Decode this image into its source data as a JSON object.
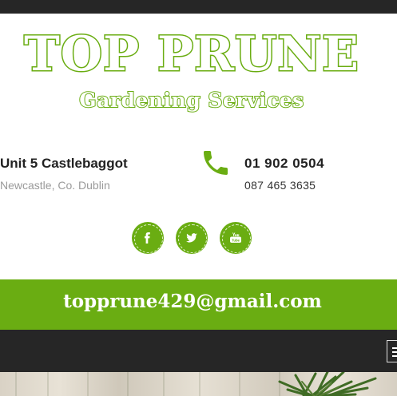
{
  "logo": {
    "title": "TOP PRUNE",
    "subtitle": "Gardening Services",
    "brand_color": "#6aad12"
  },
  "address": {
    "line1": "Unit 5 Castlebaggot",
    "line2": "Newcastle, Co. Dublin"
  },
  "contact": {
    "icon": "phone-icon",
    "phone_main": "01 902 0504",
    "phone_alt": "087 465 3635"
  },
  "social": [
    {
      "network": "facebook",
      "icon": "facebook-icon"
    },
    {
      "network": "twitter",
      "icon": "twitter-icon"
    },
    {
      "network": "youtube",
      "icon": "youtube-icon"
    }
  ],
  "email": {
    "address": "topprune429@gmail.com"
  },
  "nav": {
    "menu_icon": "hamburger-menu-icon"
  },
  "colors": {
    "accent": "#6aad12",
    "dark": "#262626",
    "text": "#222222",
    "muted": "#9a9a9a"
  }
}
